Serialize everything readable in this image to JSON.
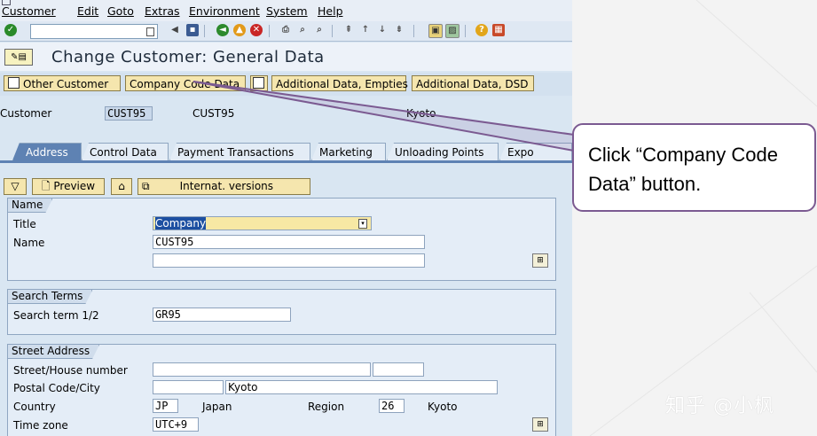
{
  "menu": [
    "Customer",
    "Edit",
    "Goto",
    "Extras",
    "Environment",
    "System",
    "Help"
  ],
  "window": {
    "title": "Change Customer: General Data"
  },
  "app_toolbar": {
    "other_customer": "Other Customer",
    "company_code_data": "Company Code Data",
    "additional_empties": "Additional Data, Empties",
    "additional_dsd": "Additional Data, DSD"
  },
  "customer": {
    "label": "Customer",
    "id": "CUST95",
    "name": "CUST95",
    "city": "Kyoto"
  },
  "tabs": [
    "Address",
    "Control Data",
    "Payment Transactions",
    "Marketing",
    "Unloading Points",
    "Expo"
  ],
  "subtoolbar": {
    "preview": "Preview",
    "intl_versions": "Internat. versions"
  },
  "name_group": {
    "title": "Name",
    "title_label": "Title",
    "title_value": "Company",
    "name_label": "Name",
    "name_value": "CUST95"
  },
  "search_group": {
    "title": "Search Terms",
    "label": "Search term 1/2",
    "value": "GR95"
  },
  "street_group": {
    "title": "Street Address",
    "street_label": "Street/House number",
    "postal_label": "Postal Code/City",
    "city_value": "Kyoto",
    "country_label": "Country",
    "country_code": "JP",
    "country_name": "Japan",
    "region_label": "Region",
    "region_code": "26",
    "region_name": "Kyoto",
    "tz_label": "Time zone",
    "tz_value": "UTC+9"
  },
  "callout": {
    "line1": "Click “Company Code",
    "line2": "Data” button."
  },
  "watermark": "知乎 @小枫",
  "colors": {
    "callout_border": "#7b5a91",
    "pointer": "#7b5a91",
    "button_bg": "#f5e6ae",
    "active_tab": "#5e82b3"
  }
}
